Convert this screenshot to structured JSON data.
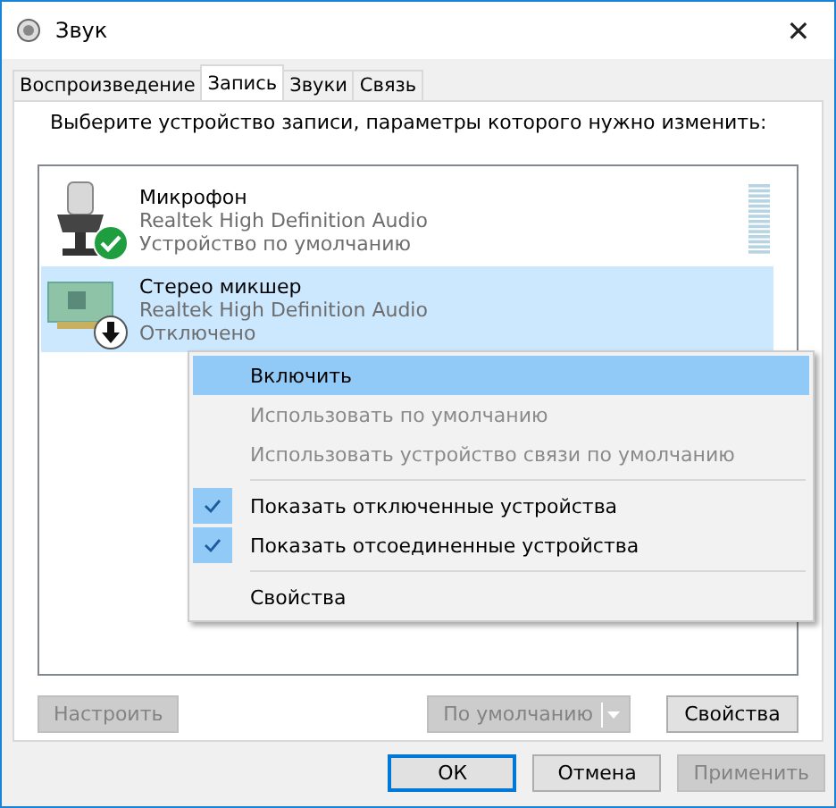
{
  "window": {
    "title": "Звук",
    "close": "✕"
  },
  "tabs": [
    {
      "label": "Воспроизведение",
      "selected": false
    },
    {
      "label": "Запись",
      "selected": true
    },
    {
      "label": "Звуки",
      "selected": false
    },
    {
      "label": "Связь",
      "selected": false
    }
  ],
  "instruction": "Выберите устройство записи, параметры которого нужно изменить:",
  "devices": [
    {
      "kind": "microphone",
      "name": "Микрофон",
      "driver": "Realtek High Definition Audio",
      "status": "Устройство по умолчанию",
      "default": true,
      "disabled": false,
      "selected": false
    },
    {
      "kind": "card",
      "name": "Стерео микшер",
      "driver": "Realtek High Definition Audio",
      "status": "Отключено",
      "default": false,
      "disabled": true,
      "selected": true
    }
  ],
  "context_menu": [
    {
      "kind": "item",
      "label": "Включить",
      "selected": true,
      "disabled": false,
      "checked": false
    },
    {
      "kind": "item",
      "label": "Использовать по умолчанию",
      "selected": false,
      "disabled": true,
      "checked": false
    },
    {
      "kind": "item",
      "label": "Использовать устройство связи по умолчанию",
      "selected": false,
      "disabled": true,
      "checked": false
    },
    {
      "kind": "separator"
    },
    {
      "kind": "item",
      "label": "Показать отключенные устройства",
      "selected": false,
      "disabled": false,
      "checked": true
    },
    {
      "kind": "item",
      "label": "Показать отсоединенные устройства",
      "selected": false,
      "disabled": false,
      "checked": true
    },
    {
      "kind": "separator"
    },
    {
      "kind": "item",
      "label": "Свойства",
      "selected": false,
      "disabled": false,
      "checked": false
    }
  ],
  "panel_buttons": {
    "configure": {
      "label": "Настроить",
      "disabled": true
    },
    "default": {
      "label": "По умолчанию",
      "disabled": true
    },
    "properties": {
      "label": "Свойства",
      "disabled": false
    }
  },
  "dialog_buttons": [
    {
      "label": "ОК",
      "disabled": false,
      "focused": true
    },
    {
      "label": "Отмена",
      "disabled": false,
      "focused": false
    },
    {
      "label": "Применить",
      "disabled": true,
      "focused": false
    }
  ]
}
